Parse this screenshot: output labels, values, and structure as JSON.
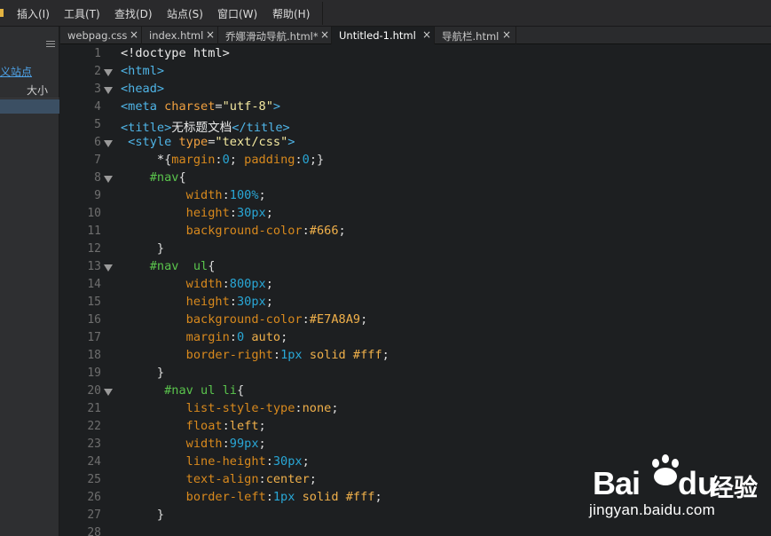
{
  "menu": [
    {
      "label": "插入(I)"
    },
    {
      "label": "工具(T)"
    },
    {
      "label": "查找(D)"
    },
    {
      "label": "站点(S)"
    },
    {
      "label": "窗口(W)"
    },
    {
      "label": "帮助(H)"
    }
  ],
  "left_panel": {
    "site_link": "义站点",
    "size_column": "大小"
  },
  "tabs": [
    {
      "label": "webpag.css",
      "active": false
    },
    {
      "label": "index.html",
      "active": false
    },
    {
      "label": "乔娜滑动导航.html*",
      "active": false
    },
    {
      "label": "Untitled-1.html",
      "active": true
    },
    {
      "label": "导航栏.html",
      "active": false
    }
  ],
  "tab_close_glyph": "×",
  "code": [
    {
      "n": "1",
      "fold": false,
      "tokens": [
        [
          "plain",
          "<!doctype html>"
        ]
      ]
    },
    {
      "n": "2",
      "fold": true,
      "tokens": [
        [
          "tag",
          "<html>"
        ]
      ]
    },
    {
      "n": "3",
      "fold": true,
      "tokens": [
        [
          "tag",
          "<head>"
        ]
      ]
    },
    {
      "n": "4",
      "fold": false,
      "tokens": [
        [
          "tag",
          "<meta "
        ],
        [
          "attr",
          "charset"
        ],
        [
          "punc",
          "="
        ],
        [
          "str",
          "\"utf-8\""
        ],
        [
          "tag",
          ">"
        ]
      ]
    },
    {
      "n": "5",
      "fold": false,
      "tokens": [
        [
          "tag",
          "<title>"
        ],
        [
          "plain",
          "无标题文档"
        ],
        [
          "tag",
          "</title>"
        ]
      ]
    },
    {
      "n": "6",
      "fold": true,
      "tokens": [
        [
          "tag",
          " <style "
        ],
        [
          "attr",
          "type"
        ],
        [
          "punc",
          "="
        ],
        [
          "str",
          "\"text/css\""
        ],
        [
          "tag",
          ">"
        ]
      ]
    },
    {
      "n": "7",
      "fold": false,
      "tokens": [
        [
          "plain",
          "     *"
        ],
        [
          "punc",
          "{"
        ],
        [
          "prop",
          "margin"
        ],
        [
          "punc",
          ":"
        ],
        [
          "num",
          "0"
        ],
        [
          "punc",
          "; "
        ],
        [
          "prop",
          "padding"
        ],
        [
          "punc",
          ":"
        ],
        [
          "num",
          "0"
        ],
        [
          "punc",
          ";}"
        ]
      ]
    },
    {
      "n": "8",
      "fold": true,
      "tokens": [
        [
          "sel",
          "    #nav"
        ],
        [
          "punc",
          "{"
        ]
      ]
    },
    {
      "n": "9",
      "fold": false,
      "tokens": [
        [
          "prop",
          "         width"
        ],
        [
          "punc",
          ":"
        ],
        [
          "num",
          "100%"
        ],
        [
          "punc",
          ";"
        ]
      ]
    },
    {
      "n": "10",
      "fold": false,
      "tokens": [
        [
          "prop",
          "         height"
        ],
        [
          "punc",
          ":"
        ],
        [
          "num",
          "30px"
        ],
        [
          "punc",
          ";"
        ]
      ]
    },
    {
      "n": "11",
      "fold": false,
      "tokens": [
        [
          "prop",
          "         background-color"
        ],
        [
          "punc",
          ":"
        ],
        [
          "hex",
          "#666"
        ],
        [
          "punc",
          ";"
        ]
      ]
    },
    {
      "n": "12",
      "fold": false,
      "tokens": [
        [
          "punc",
          "     }"
        ]
      ]
    },
    {
      "n": "13",
      "fold": true,
      "tokens": [
        [
          "sel",
          "    #nav  ul"
        ],
        [
          "punc",
          "{"
        ]
      ]
    },
    {
      "n": "14",
      "fold": false,
      "tokens": [
        [
          "prop",
          "         width"
        ],
        [
          "punc",
          ":"
        ],
        [
          "num",
          "800px"
        ],
        [
          "punc",
          ";"
        ]
      ]
    },
    {
      "n": "15",
      "fold": false,
      "tokens": [
        [
          "prop",
          "         height"
        ],
        [
          "punc",
          ":"
        ],
        [
          "num",
          "30px"
        ],
        [
          "punc",
          ";"
        ]
      ]
    },
    {
      "n": "16",
      "fold": false,
      "tokens": [
        [
          "prop",
          "         background-color"
        ],
        [
          "punc",
          ":"
        ],
        [
          "hex",
          "#E7A8A9"
        ],
        [
          "punc",
          ";"
        ]
      ]
    },
    {
      "n": "17",
      "fold": false,
      "tokens": [
        [
          "prop",
          "         margin"
        ],
        [
          "punc",
          ":"
        ],
        [
          "num",
          "0 "
        ],
        [
          "val",
          "auto"
        ],
        [
          "punc",
          ";"
        ]
      ]
    },
    {
      "n": "18",
      "fold": false,
      "tokens": [
        [
          "prop",
          "         border-right"
        ],
        [
          "punc",
          ":"
        ],
        [
          "num",
          "1px "
        ],
        [
          "val",
          "solid "
        ],
        [
          "hex",
          "#fff"
        ],
        [
          "punc",
          ";"
        ]
      ]
    },
    {
      "n": "19",
      "fold": false,
      "tokens": [
        [
          "punc",
          "     }"
        ]
      ]
    },
    {
      "n": "20",
      "fold": true,
      "tokens": [
        [
          "sel",
          "      #nav ul li"
        ],
        [
          "punc",
          "{"
        ]
      ]
    },
    {
      "n": "21",
      "fold": false,
      "tokens": [
        [
          "prop",
          "         list-style-type"
        ],
        [
          "punc",
          ":"
        ],
        [
          "val",
          "none"
        ],
        [
          "punc",
          ";"
        ]
      ]
    },
    {
      "n": "22",
      "fold": false,
      "tokens": [
        [
          "prop",
          "         float"
        ],
        [
          "punc",
          ":"
        ],
        [
          "val",
          "left"
        ],
        [
          "punc",
          ";"
        ]
      ]
    },
    {
      "n": "23",
      "fold": false,
      "tokens": [
        [
          "prop",
          "         width"
        ],
        [
          "punc",
          ":"
        ],
        [
          "num",
          "99px"
        ],
        [
          "punc",
          ";"
        ]
      ]
    },
    {
      "n": "24",
      "fold": false,
      "tokens": [
        [
          "prop",
          "         line-height"
        ],
        [
          "punc",
          ":"
        ],
        [
          "num",
          "30px"
        ],
        [
          "punc",
          ";"
        ]
      ]
    },
    {
      "n": "25",
      "fold": false,
      "tokens": [
        [
          "prop",
          "         text-align"
        ],
        [
          "punc",
          ":"
        ],
        [
          "val",
          "center"
        ],
        [
          "punc",
          ";"
        ]
      ]
    },
    {
      "n": "26",
      "fold": false,
      "tokens": [
        [
          "prop",
          "         border-left"
        ],
        [
          "punc",
          ":"
        ],
        [
          "num",
          "1px "
        ],
        [
          "val",
          "solid "
        ],
        [
          "hex",
          "#fff"
        ],
        [
          "punc",
          ";"
        ]
      ]
    },
    {
      "n": "27",
      "fold": false,
      "tokens": [
        [
          "punc",
          "     }"
        ]
      ]
    },
    {
      "n": "28",
      "fold": false,
      "tokens": []
    }
  ],
  "watermark": {
    "bai": "Bai",
    "du": "du",
    "jingyan": "经验",
    "url": "jingyan.baidu.com"
  },
  "colors": {
    "editor_bg": "#1d1f21",
    "tag": "#4fb4e6",
    "selector": "#5ac44c",
    "property": "#d8891d",
    "number": "#29a7d6",
    "string": "#f4e9a0"
  }
}
